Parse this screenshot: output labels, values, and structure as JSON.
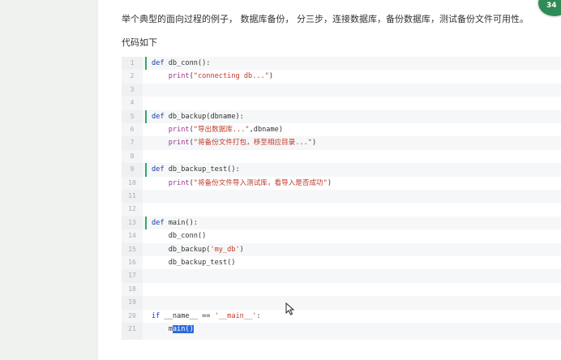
{
  "article": {
    "intro": "举个典型的面向过程的例子， 数据库备份， 分三步，连接数据库，备份数据库，测试备份文件可用性。",
    "subhead": "代码如下"
  },
  "badge": {
    "text": "34"
  },
  "code_lines": [
    {
      "n": "1",
      "text": "def db_conn():"
    },
    {
      "n": "2",
      "text": "    print(\"connecting db...\")"
    },
    {
      "n": "3",
      "text": ""
    },
    {
      "n": "4",
      "text": ""
    },
    {
      "n": "5",
      "text": "def db_backup(dbname):"
    },
    {
      "n": "6",
      "text": "    print(\"导出数据库...\",dbname)"
    },
    {
      "n": "7",
      "text": "    print(\"将备份文件打包，移至相应目录...\")"
    },
    {
      "n": "8",
      "text": ""
    },
    {
      "n": "9",
      "text": "def db_backup_test():"
    },
    {
      "n": "10",
      "text": "    print(\"将备份文件导入测试库，看导入是否成功\")"
    },
    {
      "n": "11",
      "text": ""
    },
    {
      "n": "12",
      "text": ""
    },
    {
      "n": "13",
      "text": "def main():"
    },
    {
      "n": "14",
      "text": "    db_conn()"
    },
    {
      "n": "15",
      "text": "    db_backup('my_db')"
    },
    {
      "n": "16",
      "text": "    db_backup_test()"
    },
    {
      "n": "17",
      "text": ""
    },
    {
      "n": "18",
      "text": ""
    },
    {
      "n": "19",
      "text": ""
    },
    {
      "n": "20",
      "text": "if __name__ == '__main__':"
    },
    {
      "n": "21",
      "text": "    main()"
    }
  ],
  "selection": {
    "line": "21",
    "text": "ain()"
  },
  "icons": {
    "cursor": "mouse-pointer-icon"
  }
}
